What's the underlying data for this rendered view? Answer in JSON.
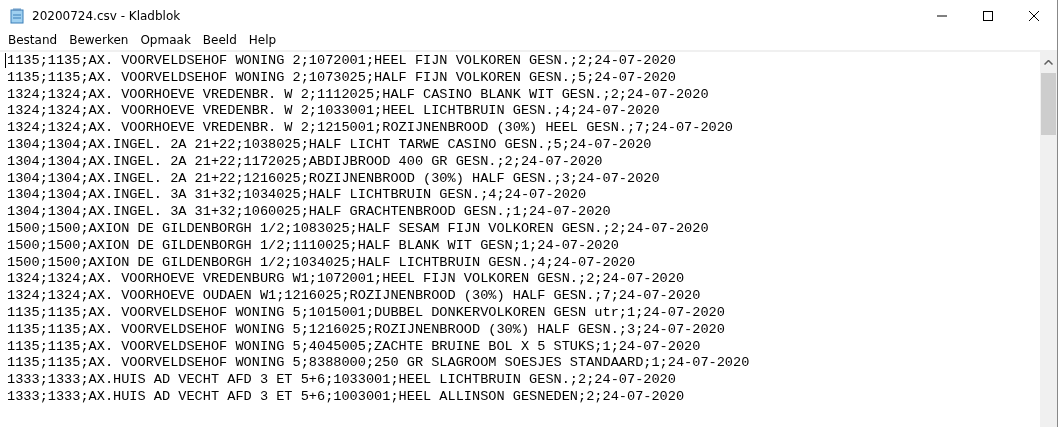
{
  "window": {
    "title": "20200724.csv - Kladblok"
  },
  "menu": [
    "Bestand",
    "Bewerken",
    "Opmaak",
    "Beeld",
    "Help"
  ],
  "lines": [
    "1135;1135;AX. VOORVELDSEHOF WONING 2;1072001;HEEL FIJN VOLKOREN GESN.;2;24-07-2020",
    "1135;1135;AX. VOORVELDSEHOF WONING 2;1073025;HALF FIJN VOLKOREN GESN.;5;24-07-2020",
    "1324;1324;AX. VOORHOEVE VREDENBR. W 2;1112025;HALF CASINO BLANK WIT GESN.;2;24-07-2020",
    "1324;1324;AX. VOORHOEVE VREDENBR. W 2;1033001;HEEL LICHTBRUIN GESN.;4;24-07-2020",
    "1324;1324;AX. VOORHOEVE VREDENBR. W 2;1215001;ROZIJNENBROOD (30%) HEEL GESN.;7;24-07-2020",
    "1304;1304;AX.INGEL. 2A 21+22;1038025;HALF LICHT TARWE CASINO GESN.;5;24-07-2020",
    "1304;1304;AX.INGEL. 2A 21+22;1172025;ABDIJBROOD 400 GR GESN.;2;24-07-2020",
    "1304;1304;AX.INGEL. 2A 21+22;1216025;ROZIJNENBROOD (30%) HALF GESN.;3;24-07-2020",
    "1304;1304;AX.INGEL. 3A 31+32;1034025;HALF LICHTBRUIN GESN.;4;24-07-2020",
    "1304;1304;AX.INGEL. 3A 31+32;1060025;HALF GRACHTENBROOD GESN.;1;24-07-2020",
    "1500;1500;AXION DE GILDENBORGH 1/2;1083025;HALF SESAM FIJN VOLKOREN GESN.;2;24-07-2020",
    "1500;1500;AXION DE GILDENBORGH 1/2;1110025;HALF BLANK WIT GESN;1;24-07-2020",
    "1500;1500;AXION DE GILDENBORGH 1/2;1034025;HALF LICHTBRUIN GESN.;4;24-07-2020",
    "1324;1324;AX. VOORHOEVE VREDENBURG W1;1072001;HEEL FIJN VOLKOREN GESN.;2;24-07-2020",
    "1324;1324;AX. VOORHOEVE OUDAEN W1;1216025;ROZIJNENBROOD (30%) HALF GESN.;7;24-07-2020",
    "1135;1135;AX. VOORVELDSEHOF WONING 5;1015001;DUBBEL DONKERVOLKOREN GESN utr;1;24-07-2020",
    "1135;1135;AX. VOORVELDSEHOF WONING 5;1216025;ROZIJNENBROOD (30%) HALF GESN.;3;24-07-2020",
    "1135;1135;AX. VOORVELDSEHOF WONING 5;4045005;ZACHTE BRUINE BOL X 5 STUKS;1;24-07-2020",
    "1135;1135;AX. VOORVELDSEHOF WONING 5;8388000;250 GR SLAGROOM SOESJES STANDAARD;1;24-07-2020",
    "1333;1333;AX.HUIS AD VECHT AFD 3 ET 5+6;1033001;HEEL LICHTBRUIN GESN.;2;24-07-2020",
    "1333;1333;AX.HUIS AD VECHT AFD 3 ET 5+6;1003001;HEEL ALLINSON GESNEDEN;2;24-07-2020"
  ]
}
